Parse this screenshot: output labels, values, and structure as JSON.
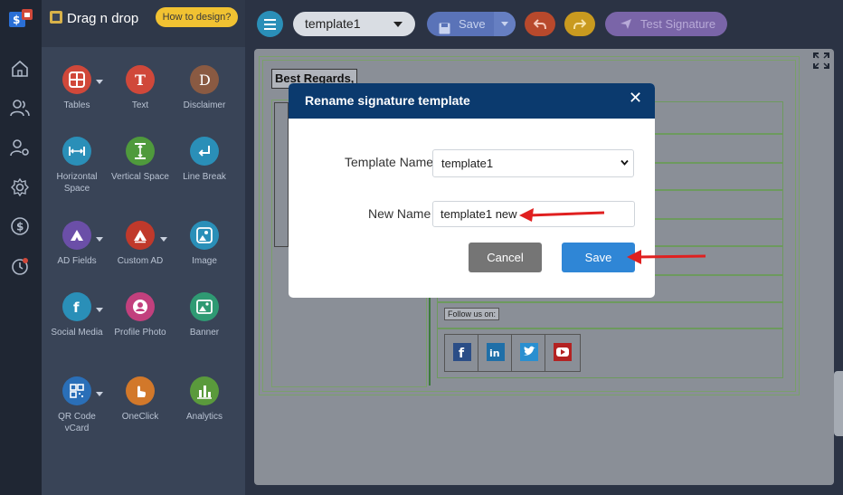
{
  "panel": {
    "title": "Drag n drop",
    "howto_label": "How to design?",
    "tools": [
      {
        "label": "Tables",
        "icon": "table-icon",
        "color": "#d0483a"
      },
      {
        "label": "Text",
        "icon": "text-t-icon",
        "color": "#d0483a"
      },
      {
        "label": "Disclaimer",
        "icon": "disclaimer-d-icon",
        "color": "#8a5a42"
      },
      {
        "label": "Horizontal Space",
        "icon": "horizontal-space-icon",
        "color": "#2a8fb8"
      },
      {
        "label": "Vertical Space",
        "icon": "vertical-space-icon",
        "color": "#4f9a3c"
      },
      {
        "label": "Line Break",
        "icon": "line-break-icon",
        "color": "#2a8fb8"
      },
      {
        "label": "AD Fields",
        "icon": "ad-fields-icon",
        "color": "#6b4fa8"
      },
      {
        "label": "Custom AD",
        "icon": "custom-ad-icon",
        "color": "#c0392b"
      },
      {
        "label": "Image",
        "icon": "image-icon",
        "color": "#2a8fb8"
      },
      {
        "label": "Social Media",
        "icon": "social-media-icon",
        "color": "#2a8fb8"
      },
      {
        "label": "Profile Photo",
        "icon": "profile-photo-icon",
        "color": "#c2407d"
      },
      {
        "label": "Banner",
        "icon": "banner-icon",
        "color": "#2f9a73"
      },
      {
        "label": "QR Code vCard",
        "icon": "qr-code-icon",
        "color": "#2a6fb8"
      },
      {
        "label": "OneClick",
        "icon": "oneclick-hand-icon",
        "color": "#d2782a"
      },
      {
        "label": "Analytics",
        "icon": "analytics-icon",
        "color": "#5a9a3c"
      }
    ]
  },
  "toolbar": {
    "template_value": "template1",
    "save_label": "Save",
    "test_signature_label": "Test Signature"
  },
  "canvas": {
    "best_regards": "Best Regards,",
    "follow_us": "Follow us on:"
  },
  "modal": {
    "title": "Rename signature template",
    "close_symbol": "✕",
    "template_name_label": "Template Name",
    "template_name_value": "template1",
    "new_name_label": "New Name",
    "new_name_value": "template1 new",
    "cancel_label": "Cancel",
    "save_label": "Save"
  },
  "colors": {
    "modal_header": "#0b3a6e",
    "save_button": "#2f86d6",
    "cancel_button": "#757575",
    "arrow": "#e02020"
  }
}
